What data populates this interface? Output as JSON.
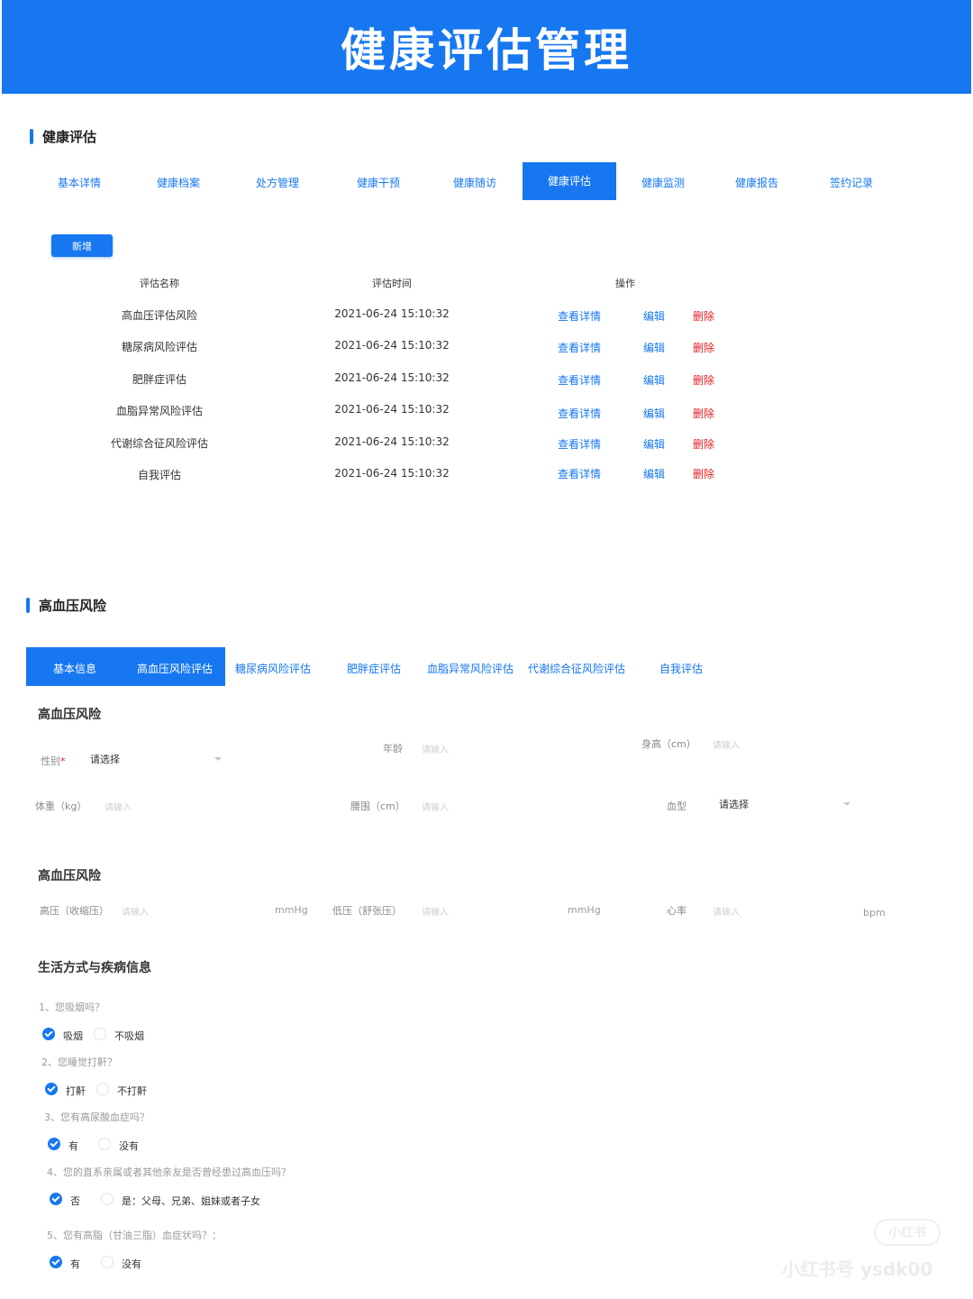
{
  "banner": {
    "title": "健康评估管理"
  },
  "section1": {
    "title": "健康评估",
    "tabs": [
      "基本详情",
      "健康档案",
      "处方管理",
      "健康干预",
      "健康随访",
      "健康评估",
      "健康监测",
      "健康报告",
      "签约记录"
    ],
    "add_button": "新增",
    "table": {
      "headers": [
        "评估名称",
        "评估时间",
        "操作"
      ],
      "rows": [
        {
          "name": "高血压评估风险",
          "time": "2021-06-24 15:10:32"
        },
        {
          "name": "糖尿病风险评估",
          "time": "2021-06-24 15:10:32"
        },
        {
          "name": "肥胖症评估",
          "time": "2021-06-24 15:10:32"
        },
        {
          "name": "血脂异常风险评估",
          "time": "2021-06-24 15:10:32"
        },
        {
          "name": "代谢综合征风险评估",
          "time": "2021-06-24 15:10:32"
        },
        {
          "name": "自我评估",
          "time": "2021-06-24 15:10:32"
        }
      ],
      "actions": {
        "view": "查看详情",
        "edit": "编辑",
        "delete": "删除"
      }
    }
  },
  "section2": {
    "title": "高血压风险",
    "tabs": [
      "基本信息",
      "高血压风险评估",
      "糖尿病风险评估",
      "肥胖症评估",
      "血脂异常风险评估",
      "代谢综合征风险评估",
      "自我评估"
    ],
    "basic": {
      "heading": "高血压风险",
      "gender_label": "性别",
      "gender_required": "*",
      "gender_value": "请选择",
      "age_label": "年龄",
      "age_placeholder": "请输入",
      "height_label": "身高（cm）",
      "height_placeholder": "请输入",
      "weight_label": "体重（kg）",
      "weight_placeholder": "请输入",
      "waist_label": "腰围（cm）",
      "waist_placeholder": "请输入",
      "blood_label": "血型",
      "blood_value": "请选择"
    },
    "bp": {
      "heading": "高血压风险",
      "sys_label": "高压（收缩压）",
      "sys_placeholder": "请输入",
      "sys_unit": "mmHg",
      "dia_label": "低压（舒张压）",
      "dia_placeholder": "请输入",
      "dia_unit": "mmHg",
      "hr_label": "心率",
      "hr_placeholder": "请输入",
      "hr_unit": "bpm"
    },
    "lifestyle": {
      "heading": "生活方式与疾病信息",
      "questions": [
        {
          "q": "1、您吸烟吗？",
          "opt1": "吸烟",
          "opt2": "不吸烟"
        },
        {
          "q": "2、您睡觉打鼾？",
          "opt1": "打鼾",
          "opt2": "不打鼾"
        },
        {
          "q": "3、您有高尿酸血症吗？",
          "opt1": "有",
          "opt2": "没有"
        },
        {
          "q": "4、您的直系亲属或者其他亲友是否曾经患过高血压吗？",
          "opt1": "否",
          "opt2": "是：父母、兄弟、姐妹或者子女"
        },
        {
          "q": "5、您有高脂（甘油三脂）血症状吗？：",
          "opt1": "有",
          "opt2": "没有"
        }
      ]
    }
  },
  "watermark": {
    "logo": "小红书",
    "text": "小红书号 ysdk00"
  }
}
